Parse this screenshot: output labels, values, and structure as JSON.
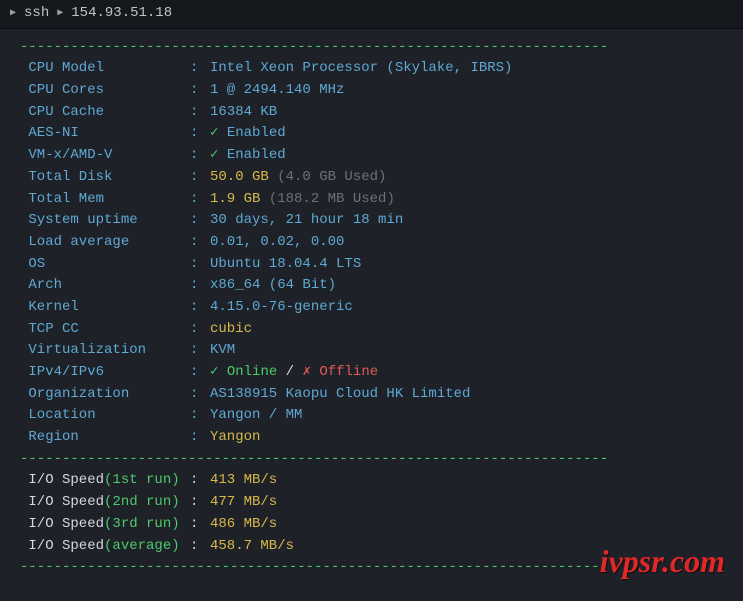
{
  "header": {
    "ssh_label": "ssh",
    "ip": "154.93.51.18"
  },
  "divider": "----------------------------------------------------------------------",
  "info": [
    {
      "label": "CPU Model",
      "value": "Intel Xeon Processor (Skylake, IBRS)",
      "style": "value"
    },
    {
      "label": "CPU Cores",
      "value": "1 @ 2494.140 MHz",
      "style": "value"
    },
    {
      "label": "CPU Cache",
      "value": "16384 KB",
      "style": "value"
    },
    {
      "label": "AES-NI",
      "value": "Enabled",
      "check": true,
      "style": "value"
    },
    {
      "label": "VM-x/AMD-V",
      "value": "Enabled",
      "check": true,
      "style": "value"
    },
    {
      "label": "Total Disk",
      "value": "50.0 GB",
      "suffix": "(4.0 GB Used)",
      "style": "value-yellow"
    },
    {
      "label": "Total Mem",
      "value": "1.9 GB",
      "suffix": "(188.2 MB Used)",
      "style": "value-yellow"
    },
    {
      "label": "System uptime",
      "value": "30 days, 21 hour 18 min",
      "style": "value"
    },
    {
      "label": "Load average",
      "value": "0.01, 0.02, 0.00",
      "style": "value"
    },
    {
      "label": "OS",
      "value": "Ubuntu 18.04.4 LTS",
      "style": "value"
    },
    {
      "label": "Arch",
      "value": "x86_64 (64 Bit)",
      "style": "value"
    },
    {
      "label": "Kernel",
      "value": "4.15.0-76-generic",
      "style": "value"
    },
    {
      "label": "TCP CC",
      "value": "cubic",
      "style": "value-yellow"
    },
    {
      "label": "Virtualization",
      "value": "KVM",
      "style": "value"
    },
    {
      "label": "IPv4/IPv6",
      "online": "Online",
      "offline": "Offline",
      "style": "ipv"
    },
    {
      "label": "Organization",
      "value": "AS138915 Kaopu Cloud HK Limited",
      "style": "value"
    },
    {
      "label": "Location",
      "value": "Yangon / MM",
      "style": "value"
    },
    {
      "label": "Region",
      "value": "Yangon",
      "style": "value-yellow"
    }
  ],
  "io": [
    {
      "label": "I/O Speed",
      "run": "1st run",
      "value": "413 MB/s"
    },
    {
      "label": "I/O Speed",
      "run": "2nd run",
      "value": "477 MB/s"
    },
    {
      "label": "I/O Speed",
      "run": "3rd run",
      "value": "486 MB/s"
    },
    {
      "label": "I/O Speed",
      "run": "average",
      "value": "458.7 MB/s"
    }
  ],
  "watermark": "ivpsr.com"
}
